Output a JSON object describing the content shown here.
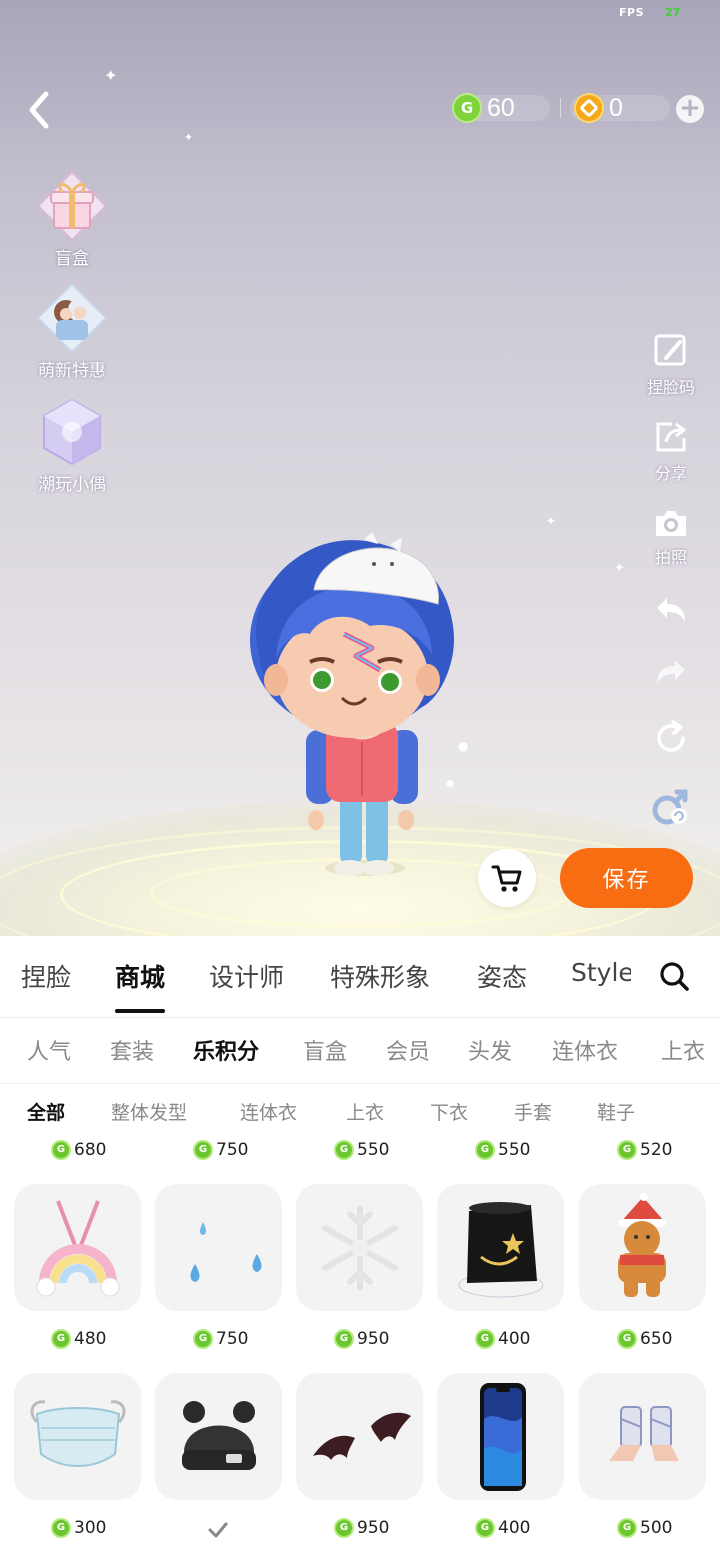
{
  "status": {
    "fps_label": "FPS",
    "fps_value": "27"
  },
  "currency": {
    "green_amount": "60",
    "gold_amount": "0",
    "green_coin_symbol": "G"
  },
  "left_menu": [
    {
      "label": "盲盒",
      "icon": "gift-box-icon"
    },
    {
      "label": "萌新特惠",
      "icon": "newbie-deal-icon"
    },
    {
      "label": "潮玩小偶",
      "icon": "figure-box-icon"
    }
  ],
  "right_menu": [
    {
      "label": "捏脸码",
      "icon": "face-code-icon"
    },
    {
      "label": "分享",
      "icon": "share-icon"
    },
    {
      "label": "拍照",
      "icon": "camera-icon"
    },
    {
      "icon": "undo-icon"
    },
    {
      "icon": "redo-icon"
    },
    {
      "icon": "reset-icon"
    },
    {
      "icon": "gender-switch-icon"
    }
  ],
  "actions": {
    "save_label": "保存"
  },
  "main_tabs": [
    "捏脸",
    "商城",
    "设计师",
    "特殊形象",
    "姿态",
    "Style"
  ],
  "main_tab_active": "商城",
  "sub_tabs": [
    "人气",
    "套装",
    "乐积分",
    "盲盒",
    "会员",
    "头发",
    "连体衣",
    "上衣"
  ],
  "sub_tab_active": "乐积分",
  "category_tabs": [
    "全部",
    "整体发型",
    "连体衣",
    "上衣",
    "下衣",
    "手套",
    "鞋子"
  ],
  "category_tab_active": "全部",
  "partial_row_prices": [
    "680",
    "750",
    "550",
    "550",
    "520"
  ],
  "items_row1": [
    {
      "name": "rainbow-bag",
      "price": "480"
    },
    {
      "name": "teardrops",
      "price": "750"
    },
    {
      "name": "snowflake",
      "price": "950"
    },
    {
      "name": "black-hat",
      "price": "400"
    },
    {
      "name": "gingerbread",
      "price": "650"
    }
  ],
  "items_row2": [
    {
      "name": "face-mask",
      "price": "300"
    },
    {
      "name": "bear-beanie",
      "owned": true
    },
    {
      "name": "bat-wings",
      "price": "950"
    },
    {
      "name": "smartphone",
      "price": "400"
    },
    {
      "name": "bandage-feet",
      "price": "500"
    }
  ],
  "colors": {
    "accent": "#f86d12",
    "coin_green": "#6cc62f",
    "coin_gold": "#f4a91b"
  }
}
